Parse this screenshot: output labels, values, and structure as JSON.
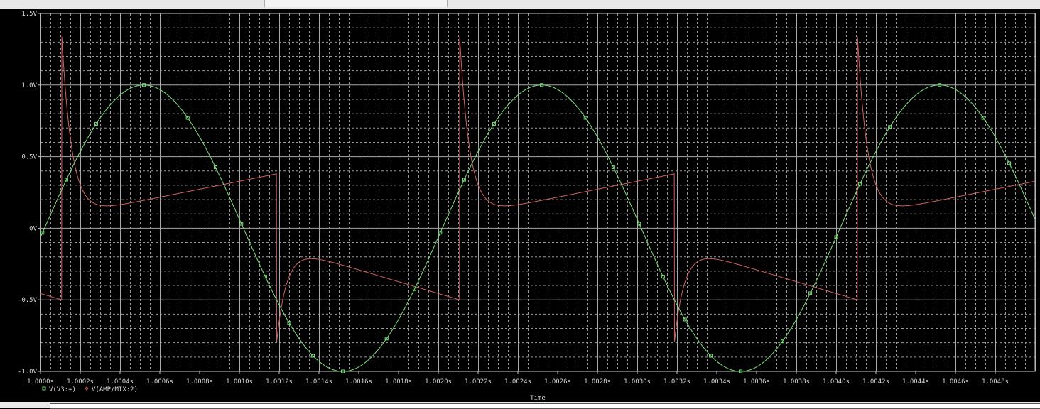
{
  "chart_data": {
    "type": "line",
    "title": "",
    "xlabel": "Time",
    "ylabel": "",
    "xlim": [
      1.0,
      1.005
    ],
    "ylim": [
      -1.0,
      1.5
    ],
    "grid": true,
    "x_ticks": [
      1.0,
      1.0002,
      1.0004,
      1.0006,
      1.0008,
      1.001,
      1.0012,
      1.0014,
      1.0016,
      1.0018,
      1.002,
      1.0022,
      1.0024,
      1.0026,
      1.0028,
      1.003,
      1.0032,
      1.0034,
      1.0036,
      1.0038,
      1.004,
      1.0042,
      1.0044,
      1.0046,
      1.0048
    ],
    "x_tick_labels": [
      "1.0000s",
      "1.0002s",
      "1.0004s",
      "1.0006s",
      "1.0008s",
      "1.0010s",
      "1.0012s",
      "1.0014s",
      "1.0016s",
      "1.0018s",
      "1.0020s",
      "1.0022s",
      "1.0024s",
      "1.0026s",
      "1.0028s",
      "1.0030s",
      "1.0032s",
      "1.0034s",
      "1.0036s",
      "1.0038s",
      "1.0040s",
      "1.0042s",
      "1.0044s",
      "1.0046s",
      "1.0048s"
    ],
    "y_ticks": [
      1.5,
      1.0,
      0.5,
      0,
      -0.5,
      -1.0
    ],
    "y_tick_labels": [
      "1.5V",
      "1.0V",
      "0.5V",
      "0V",
      "-0.5V",
      "-1.0V"
    ],
    "legend_position": "bottom-left",
    "series": [
      {
        "name": "V(V3:+)",
        "color": "#7ee07e",
        "marker": "square",
        "model": "sine",
        "amplitude": 1.0,
        "period_s": 0.002,
        "zero_cross_s": 1.00002,
        "marker_times_s": [
          1.00001,
          1.00013,
          1.00028,
          1.00052,
          1.00074,
          1.00088,
          1.00101,
          1.00113,
          1.00125,
          1.00137,
          1.00152,
          1.00174,
          1.00188,
          1.00201,
          1.00213,
          1.00228,
          1.00252,
          1.00274,
          1.00288,
          1.00301,
          1.00313,
          1.00324,
          1.00337,
          1.00352,
          1.00373,
          1.00387,
          1.004,
          1.00412,
          1.00427,
          1.00452,
          1.00474,
          1.00487
        ]
      },
      {
        "name": "V(AMP/MIX:2)",
        "color": "#d06060",
        "marker": "diamond",
        "model": "sawtooth-with-spikes",
        "period_s": 0.002,
        "spike_times_s": [
          1.000107,
          1.002107,
          1.004107
        ],
        "spike_peak_v": 1.35,
        "drop_times_s": [
          1.001187,
          1.003187
        ],
        "drop_min_v": -0.8,
        "rise_segment_v": [
          0.13,
          0.38
        ],
        "fall_segment_v": [
          -0.19,
          -0.5
        ]
      }
    ]
  }
}
